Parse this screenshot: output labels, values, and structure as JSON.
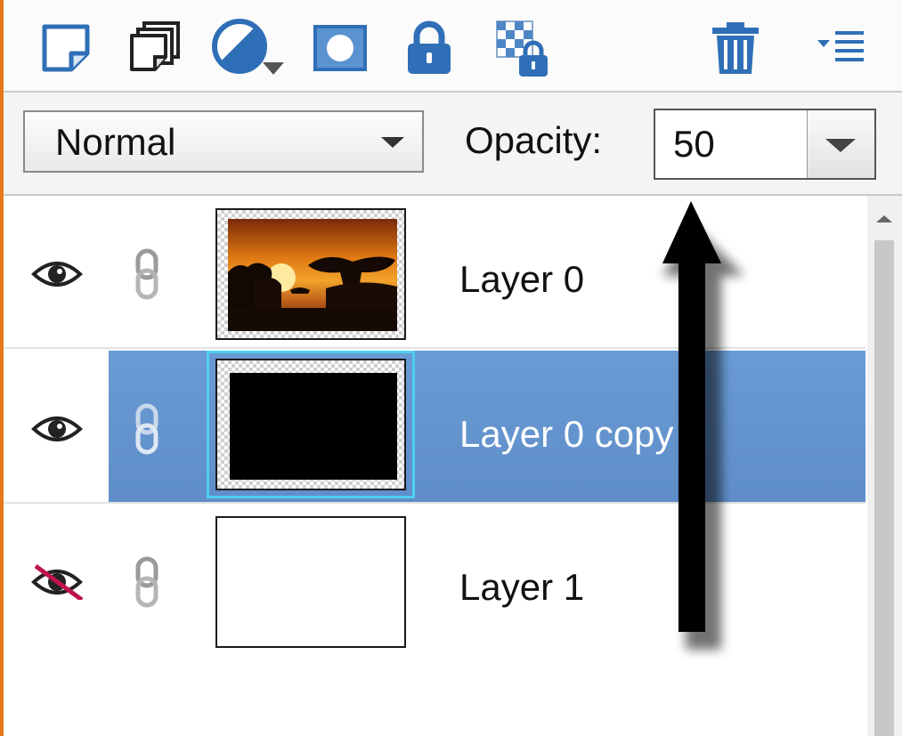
{
  "toolbar": {
    "buttons": [
      {
        "icon": "new-layer-icon"
      },
      {
        "icon": "duplicate-layer-icon"
      },
      {
        "icon": "adjustment-layer-icon"
      },
      {
        "icon": "layer-mask-icon"
      },
      {
        "icon": "lock-all-icon"
      },
      {
        "icon": "lock-transparency-icon"
      },
      {
        "icon": "delete-layer-icon"
      },
      {
        "icon": "panel-menu-icon"
      }
    ],
    "accent_color": "#2f6fb7"
  },
  "options": {
    "blend_mode": "Normal",
    "opacity_label": "Opacity:",
    "opacity_value": "50"
  },
  "layers": [
    {
      "name": "Layer 0",
      "visible": true,
      "selected": false,
      "thumbnail": "sunset-photo"
    },
    {
      "name": "Layer 0 copy",
      "visible": true,
      "selected": true,
      "thumbnail": "black-fill"
    },
    {
      "name": "Layer 1",
      "visible": false,
      "selected": false,
      "thumbnail": "empty-white"
    }
  ],
  "colors": {
    "selection": "#6a9bd4",
    "selection_outline": "#4fd0ef",
    "hidden_slash": "#c0134a"
  }
}
